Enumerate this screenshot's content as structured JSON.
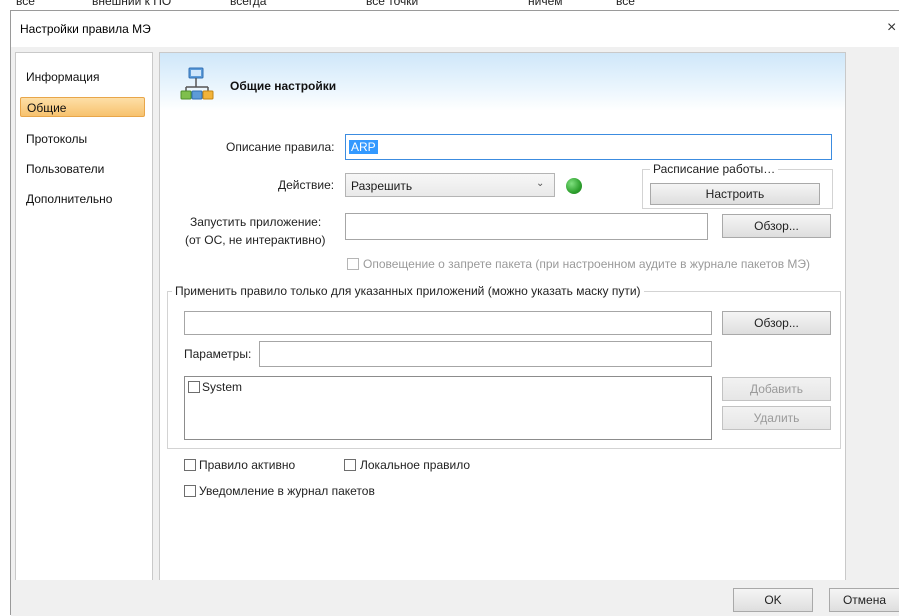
{
  "background": {
    "partial_text": [
      "все",
      "внешний к ПО",
      "всегда",
      "все точки",
      "ничем",
      "все"
    ]
  },
  "dialog": {
    "title": "Настройки правила МЭ",
    "close": "×"
  },
  "sidebar": {
    "items": [
      {
        "label": "Информация",
        "active": false
      },
      {
        "label": "Общие",
        "active": true
      },
      {
        "label": "Протоколы",
        "active": false
      },
      {
        "label": "Пользователи",
        "active": false
      },
      {
        "label": "Дополнительно",
        "active": false
      }
    ]
  },
  "header": {
    "title": "Общие настройки",
    "icon": "network-icon"
  },
  "form": {
    "description_label": "Описание правила:",
    "description_value": "ARP",
    "action_label": "Действие:",
    "action_value": "Разрешить",
    "status_color": "#2fa12f",
    "schedule_label": "Расписание работы…",
    "configure_button": "Настроить",
    "run_app_label_1": "Запустить приложение:",
    "run_app_label_2": "(от ОС, не интерактивно)",
    "run_app_value": "",
    "browse_button": "Обзор...",
    "notify_block": "Оповещение о запрете пакета (при настроенном аудите в журнале пакетов МЭ)",
    "apply_group_label": "Применить правило только для указанных приложений (можно указать маску пути)",
    "apply_path_value": "",
    "browse_button_2": "Обзор...",
    "params_label": "Параметры:",
    "params_value": "",
    "app_list": [
      "System"
    ],
    "add_button": "Добавить",
    "delete_button": "Удалить",
    "rule_active": "Правило активно",
    "local_rule": "Локальное правило",
    "log_notify": "Уведомление в журнал пакетов"
  },
  "footer": {
    "ok": "OK",
    "cancel": "Отмена"
  },
  "colors": {
    "accent": "#f7c26e",
    "header": "#cfe7f9",
    "focus": "#3c8ce0"
  }
}
